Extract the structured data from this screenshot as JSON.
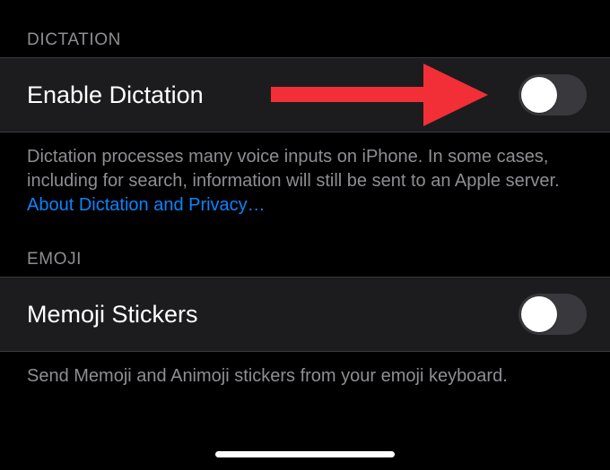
{
  "sections": {
    "dictation": {
      "header": "DICTATION",
      "row_label": "Enable Dictation",
      "toggle_on": false,
      "footer": "Dictation processes many voice inputs on iPhone. In some cases, including for search, information will still be sent to an Apple server. ",
      "footer_link": "About Dictation and Privacy…"
    },
    "emoji": {
      "header": "EMOJI",
      "row_label": "Memoji Stickers",
      "toggle_on": false,
      "footer": "Send Memoji and Animoji stickers from your emoji keyboard."
    }
  },
  "colors": {
    "link": "#0a84ff",
    "arrow": "#f22f37"
  }
}
